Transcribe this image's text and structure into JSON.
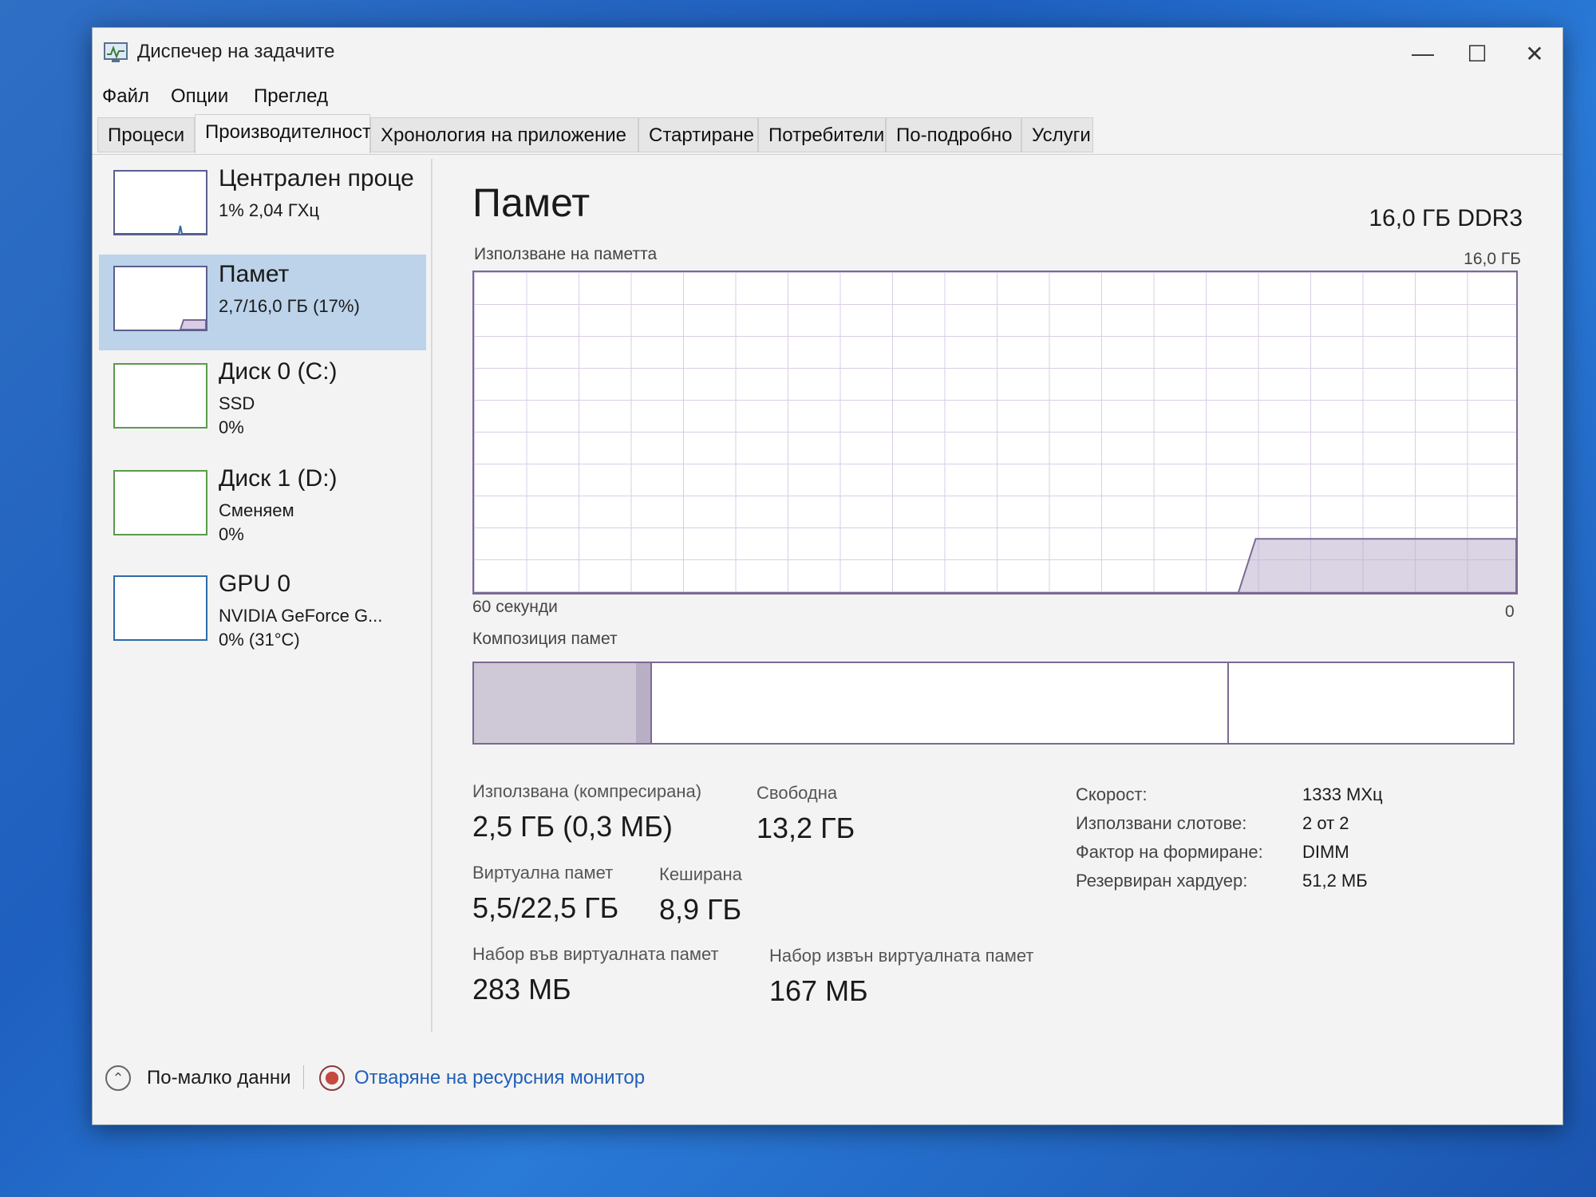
{
  "window": {
    "title": "Диспечер на задачите",
    "minimize": "—",
    "maximize": "☐",
    "close": "✕"
  },
  "menu": [
    "Файл",
    "Опции",
    "Преглед"
  ],
  "tabs": [
    "Процеси",
    "Производителност",
    "Хронология на приложение",
    "Стартиране",
    "Потребители",
    "По-подробно",
    "Услуги"
  ],
  "active_tab": 1,
  "sidebar": [
    {
      "name": "Централен проце",
      "sub1": "1% 2,04 ГХц",
      "sub2": ""
    },
    {
      "name": "Памет",
      "sub1": "2,7/16,0 ГБ (17%)",
      "sub2": ""
    },
    {
      "name": "Диск 0 (C:)",
      "sub1": "SSD",
      "sub2": "0%"
    },
    {
      "name": "Диск 1 (D:)",
      "sub1": "Сменяем",
      "sub2": "0%"
    },
    {
      "name": "GPU 0",
      "sub1": "NVIDIA GeForce G...",
      "sub2": "0% (31°C)"
    }
  ],
  "main": {
    "title": "Памет",
    "type": "16,0 ГБ DDR3",
    "usage_label": "Използване на паметта",
    "usage_max": "16,0 ГБ",
    "time_left": "60 секунди",
    "time_right": "0",
    "composition_label": "Композиция памет"
  },
  "chart_data": {
    "type": "area",
    "x_label_left": "60 секунди",
    "x_label_right": "0",
    "ylim": [
      0,
      16
    ],
    "y_max_label": "16,0 ГБ",
    "x": [
      60,
      16,
      15,
      0
    ],
    "values": [
      0,
      0,
      2.7,
      2.7
    ],
    "composition": {
      "used_fraction": 0.156,
      "modified_fraction": 0.014,
      "standby_fraction": 0.555,
      "free_fraction": 0.275
    }
  },
  "stats": {
    "used_label": "Използвана (компресирана)",
    "used_value": "2,5 ГБ (0,3 МБ)",
    "free_label": "Свободна",
    "free_value": "13,2 ГБ",
    "virtual_label": "Виртуална памет",
    "virtual_value": "5,5/22,5 ГБ",
    "cached_label": "Кеширана",
    "cached_value": "8,9 ГБ",
    "paged_label": "Набор във виртуалната памет",
    "paged_value": "283 МБ",
    "nonpaged_label": "Набор извън виртуалната памет",
    "nonpaged_value": "167 МБ"
  },
  "specs": [
    {
      "k": "Скорост:",
      "v": "1333 МХц"
    },
    {
      "k": "Използвани слотове:",
      "v": "2 от 2"
    },
    {
      "k": "Фактор на формиране:",
      "v": "DIMM"
    },
    {
      "k": "Резервиран хардуер:",
      "v": "51,2 МБ"
    }
  ],
  "footer": {
    "fewer": "По-малко данни",
    "resource_monitor": "Отваряне на ресурсния монитор"
  },
  "colors": {
    "accent_memory": "#7a6a94",
    "selected": "#bcd3ea",
    "link": "#1f5fb8"
  }
}
